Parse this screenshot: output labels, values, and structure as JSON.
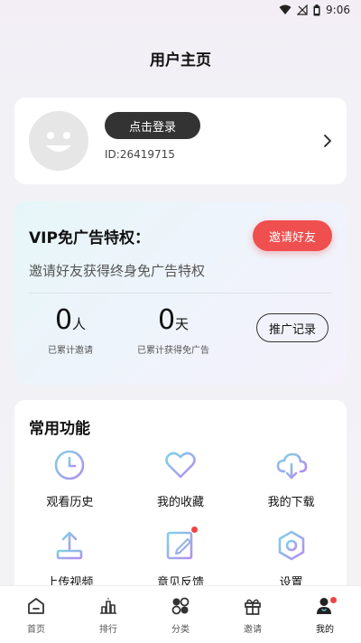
{
  "status_bar": {
    "time": "9:06"
  },
  "page": {
    "title": "用户主页"
  },
  "profile": {
    "login_label": "点击登录",
    "user_id": "ID:26419715"
  },
  "vip": {
    "title": "VIP免广告特权：",
    "invite_label": "邀请好友",
    "subtitle": "邀请好友获得终身免广告特权",
    "invited_count": "0",
    "invited_unit": "人",
    "invited_caption": "已累计邀请",
    "days_count": "0",
    "days_unit": "天",
    "days_caption": "已累计获得免广告",
    "record_label": "推广记录"
  },
  "features": {
    "title": "常用功能",
    "items": [
      {
        "label": "观看历史",
        "icon": "clock-icon"
      },
      {
        "label": "我的收藏",
        "icon": "heart-icon"
      },
      {
        "label": "我的下载",
        "icon": "cloud-download-icon"
      },
      {
        "label": "上传视频",
        "icon": "upload-icon"
      },
      {
        "label": "意见反馈",
        "icon": "edit-icon"
      },
      {
        "label": "设置",
        "icon": "hexagon-settings-icon"
      }
    ]
  },
  "tabbar": {
    "tabs": [
      {
        "label": "首页",
        "icon": "home-icon"
      },
      {
        "label": "排行",
        "icon": "rank-icon"
      },
      {
        "label": "分类",
        "icon": "category-icon"
      },
      {
        "label": "邀请",
        "icon": "gift-icon"
      },
      {
        "label": "我的",
        "icon": "user-icon",
        "active": true
      }
    ]
  },
  "colors": {
    "accent_red": "#ef4f4f",
    "icon_gradient_start": "#7fd3e6",
    "icon_gradient_end": "#b48cf0"
  }
}
